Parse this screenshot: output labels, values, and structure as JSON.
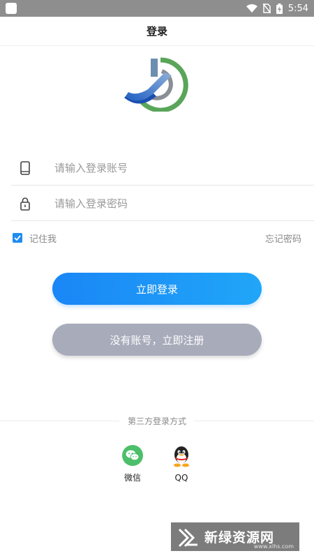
{
  "status_bar": {
    "time": "5:54"
  },
  "header": {
    "title": "登录"
  },
  "form": {
    "account_placeholder": "请输入登录账号",
    "password_placeholder": "请输入登录密码",
    "remember_label": "记住我",
    "remember_checked": true,
    "forgot_label": "忘记密码"
  },
  "buttons": {
    "login_label": "立即登录",
    "register_label": "没有账号，立即注册"
  },
  "third_party": {
    "title": "第三方登录方式",
    "items": [
      {
        "label": "微信",
        "icon": "wechat-icon"
      },
      {
        "label": "QQ",
        "icon": "qq-icon"
      }
    ]
  },
  "watermark": {
    "text": "新绿资源网",
    "url": "www.xlhs.com"
  },
  "colors": {
    "primary": "#1e8cf0",
    "secondary_button": "#a8abba",
    "status_bar": "#8e8e8e"
  }
}
